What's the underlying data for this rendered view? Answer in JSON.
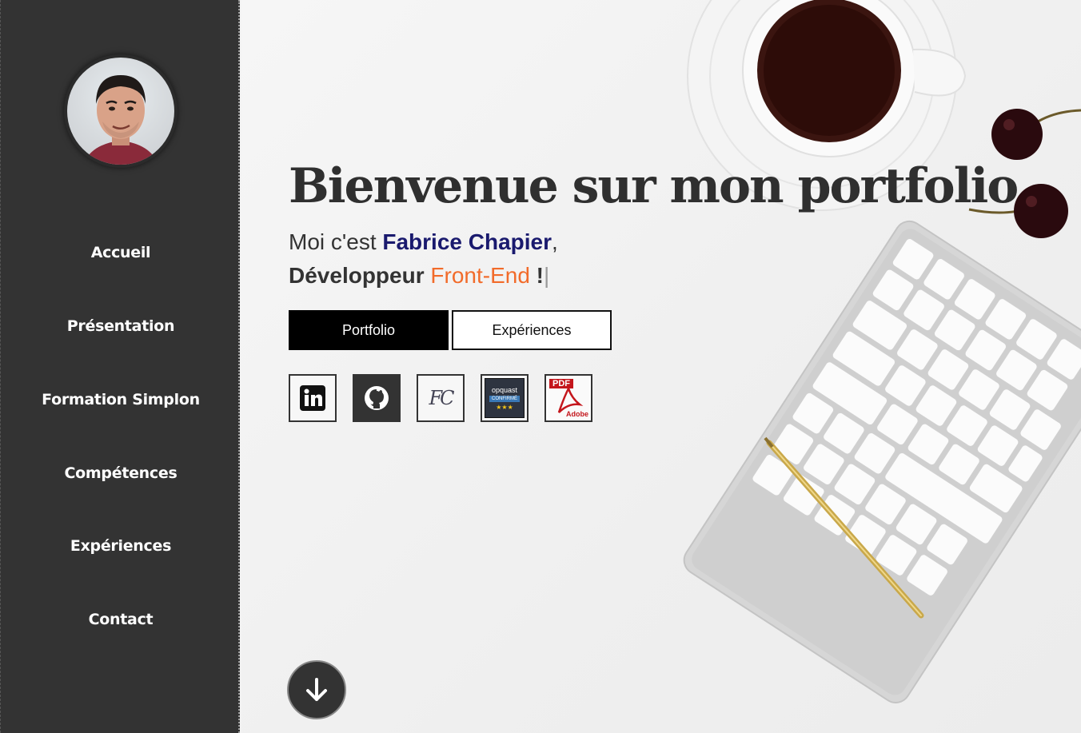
{
  "sidebar": {
    "items": [
      {
        "label": "Accueil"
      },
      {
        "label": "Présentation"
      },
      {
        "label": "Formation Simplon"
      },
      {
        "label": "Compétences"
      },
      {
        "label": "Expériences"
      },
      {
        "label": "Contact"
      }
    ]
  },
  "hero": {
    "title": "Bienvenue sur mon portfolio",
    "intro_prefix": "Moi c'est ",
    "name": "Fabrice Chapier",
    "intro_suffix": ",",
    "role_prefix": "Développeur ",
    "role": "Front-End",
    "role_suffix": " !",
    "cursor": "|"
  },
  "buttons": {
    "portfolio": "Portfolio",
    "experiences": "Expériences"
  },
  "social": [
    {
      "icon": "linkedin-icon"
    },
    {
      "icon": "github-icon"
    },
    {
      "icon": "fc-monogram-icon",
      "text": "FC"
    },
    {
      "icon": "opquast-badge-icon",
      "text": "opquast",
      "subtext": "CONFIRMÉ",
      "stars": "★★★"
    },
    {
      "icon": "pdf-cv-icon",
      "text": "PDF",
      "subtext": "Adobe"
    }
  ],
  "colors": {
    "sidebar_bg": "#333333",
    "name": "#1a1a6e",
    "role": "#f26b2a",
    "title": "#2f2f2f"
  }
}
